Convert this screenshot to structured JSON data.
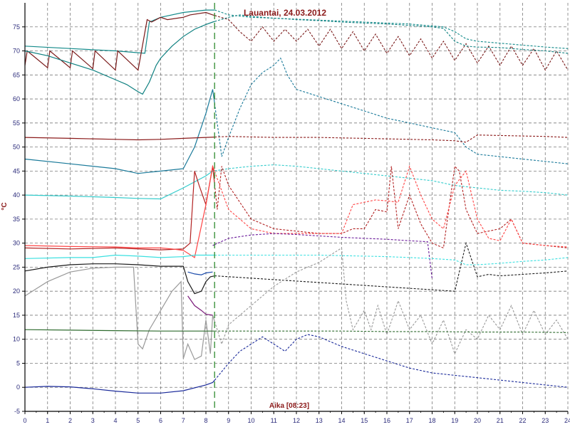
{
  "chart_data": {
    "type": "line",
    "title": "Lauantai, 24.03.2012",
    "ylabel": "°C",
    "xlabel_marker": "Aika [08:23]",
    "now_x": 8.3833,
    "xlim": [
      0,
      24
    ],
    "ylim": [
      -5,
      80
    ],
    "x_ticks": [
      "0",
      "1",
      "2",
      "3",
      "4",
      "5",
      "6",
      "7",
      "8",
      "9",
      "10",
      "11",
      "12",
      "13",
      "14",
      "15",
      "16",
      "17",
      "18",
      "19",
      "20",
      "21",
      "22",
      "23",
      "24"
    ],
    "y_ticks": [
      "-5",
      "0",
      "5",
      "10",
      "15",
      "20",
      "25",
      "30",
      "35",
      "40",
      "45",
      "50",
      "55",
      "60",
      "65",
      "70",
      "75"
    ],
    "grid": true,
    "colors": {
      "grid": "#7a7a7a",
      "axis": "#000000",
      "tick_text": "#2a2a7a",
      "title": "#8b1a1a",
      "marker_line": "#2e8b2e"
    },
    "series": [
      {
        "color": "#128a8a",
        "x": [
          0,
          2,
          4,
          5.3,
          5.5,
          6,
          7,
          8,
          8.4,
          9,
          10,
          11,
          12,
          13,
          14,
          15,
          16,
          17,
          18,
          18.5,
          19,
          19.5,
          20,
          21,
          22,
          23,
          24
        ],
        "y": [
          71,
          70.5,
          70,
          69.5,
          76,
          77,
          78,
          78.5,
          78.5,
          77.5,
          77,
          76.8,
          76.6,
          76.4,
          76.2,
          76,
          75.8,
          75.6,
          75.2,
          75,
          74,
          72.5,
          72,
          71.6,
          71.2,
          70.8,
          70.5
        ]
      },
      {
        "color": "#7a1a1a",
        "x": [
          0,
          0.1,
          1,
          1.1,
          2,
          2.1,
          3,
          3.1,
          4,
          4.1,
          5,
          5.4,
          5.6,
          6,
          6.3,
          7,
          7.3,
          8,
          8.3,
          9,
          9.5,
          10,
          10.5,
          11,
          11.5,
          12,
          12.5,
          13,
          13.5,
          14,
          14.5,
          15,
          15.5,
          16,
          16.5,
          17,
          17.5,
          18,
          18.5,
          19,
          19.5,
          20,
          20.5,
          21,
          21.5,
          22,
          22.5,
          23,
          23.5,
          24
        ],
        "y": [
          67,
          70,
          66.5,
          70,
          66.5,
          70,
          66.3,
          70,
          66,
          70,
          66,
          76.5,
          76,
          77,
          76.5,
          77,
          77.5,
          78,
          77.5,
          76.5,
          74,
          72,
          75,
          72,
          74.5,
          72,
          74.5,
          71,
          74.5,
          70.5,
          74,
          70,
          73.5,
          69.5,
          73,
          69,
          72.5,
          68.5,
          72,
          68,
          71.5,
          67.5,
          71,
          67,
          71,
          67,
          70.5,
          66,
          70,
          66
        ]
      },
      {
        "color": "#0e8080",
        "x": [
          0,
          1,
          2,
          3,
          4,
          4.5,
          5,
          5.2,
          5.5,
          5.8,
          6,
          6.5,
          7,
          7.5,
          8,
          8.3,
          9,
          9.5,
          10,
          10.5,
          11,
          11.5,
          12,
          13,
          14,
          15,
          16,
          17,
          18,
          18.5,
          19,
          19.5,
          20,
          21,
          22,
          23,
          24
        ],
        "y": [
          70,
          69,
          67.5,
          66,
          64,
          63,
          61.5,
          61,
          63.5,
          67,
          68.5,
          71,
          73,
          74.5,
          75.5,
          76,
          77,
          77.5,
          77.2,
          77,
          76.8,
          76.7,
          76.5,
          76.3,
          76,
          75.8,
          75.6,
          75.3,
          75,
          74.7,
          72,
          71,
          70.8,
          70.7,
          70.3,
          70,
          69.5
        ]
      },
      {
        "color": "#1a7a9a",
        "x": [
          0,
          2,
          4,
          5,
          6,
          7,
          7.5,
          8,
          8.3,
          8.7,
          9,
          9.5,
          10,
          10.5,
          11,
          11.3,
          11.6,
          12,
          13,
          14,
          15,
          16,
          17,
          18,
          18.5,
          19,
          19.5,
          20,
          21,
          22,
          23,
          24
        ],
        "y": [
          47.5,
          46.5,
          45.5,
          44.5,
          45,
          45.5,
          50,
          57,
          62,
          48,
          52,
          58,
          63,
          65.5,
          67,
          68.5,
          65,
          62,
          60.5,
          59,
          57.5,
          56,
          55,
          54,
          53.5,
          53,
          50,
          48.5,
          48,
          47.5,
          47,
          46.5
        ]
      },
      {
        "color": "#8b1a1a",
        "x": [
          0,
          2,
          4,
          5,
          6,
          7,
          8,
          9,
          10,
          11,
          12,
          13,
          14,
          15,
          16,
          17,
          18,
          19,
          19.5,
          20,
          21,
          22,
          23,
          24
        ],
        "y": [
          52,
          51.8,
          51.6,
          51.5,
          51.6,
          51.8,
          52,
          52.2,
          52.1,
          52,
          52,
          52,
          51.9,
          51.8,
          51.7,
          51.6,
          51.5,
          51.3,
          51,
          52.5,
          52.4,
          52.3,
          52.2,
          52
        ]
      },
      {
        "color": "#33cccc",
        "x": [
          0,
          2,
          4,
          5,
          6,
          7,
          8,
          8.3,
          9,
          10,
          11,
          12,
          13,
          14,
          15,
          16,
          17,
          18,
          19,
          20,
          21,
          22,
          23,
          24
        ],
        "y": [
          40,
          39.8,
          39.5,
          39.3,
          39.2,
          41.5,
          44,
          45,
          45.5,
          46,
          46.3,
          46,
          45.5,
          45,
          44.5,
          44,
          43.5,
          43,
          42,
          41.5,
          41,
          40.8,
          40.5,
          40
        ]
      },
      {
        "color": "#b22222",
        "x": [
          0,
          2,
          4,
          6,
          7,
          7.3,
          7.5,
          7.7,
          8,
          8.3,
          8.5,
          8.7,
          9,
          10,
          11,
          12,
          13,
          14,
          14.5,
          15,
          15.5,
          16,
          16.2,
          16.5,
          17,
          17.5,
          18,
          18.5,
          19,
          19.2,
          19.5,
          20,
          21,
          21.5,
          22,
          23,
          24
        ],
        "y": [
          29,
          28.8,
          29,
          28.6,
          28.8,
          30,
          45,
          42,
          38,
          46,
          37,
          46,
          42,
          35,
          33,
          32.5,
          32,
          32,
          33,
          33,
          37,
          36.5,
          46,
          33,
          40,
          34,
          30,
          29,
          46,
          45,
          37,
          32,
          33,
          35,
          30,
          29.5,
          29
        ]
      },
      {
        "color": "#ff4444",
        "x": [
          0,
          2,
          4,
          5,
          6,
          6.5,
          7,
          7.5,
          8,
          8.3,
          9,
          10,
          11,
          12,
          13,
          14,
          14.5,
          15,
          15.5,
          16,
          16.5,
          17,
          17.5,
          18,
          18.5,
          19,
          19.5,
          20,
          20.5,
          21,
          21.5,
          22,
          23,
          24
        ],
        "y": [
          29.5,
          29.3,
          29.2,
          29,
          29,
          28.8,
          28.5,
          27,
          38,
          46,
          37,
          33,
          32,
          32,
          32,
          32,
          38,
          38.5,
          39,
          38.8,
          38.5,
          46,
          40,
          35,
          33,
          42,
          45,
          35,
          31,
          30.5,
          35,
          30,
          29.5,
          29.2
        ]
      },
      {
        "color": "#6a1a9a",
        "x": [
          8.3,
          9,
          10,
          11,
          12,
          13,
          14,
          15,
          16,
          17,
          17.8,
          18
        ],
        "y": [
          29.5,
          31,
          31.7,
          32,
          31.8,
          31.5,
          31.2,
          31,
          30.8,
          30.5,
          30.3,
          22.5
        ]
      },
      {
        "color": "#3ae0e0",
        "x": [
          0,
          2,
          3,
          4,
          5,
          6,
          7,
          7.5,
          8,
          8.3,
          9,
          10,
          11,
          12,
          13,
          14,
          15,
          16,
          17,
          18,
          19,
          19.5,
          20,
          21,
          22,
          23,
          24
        ],
        "y": [
          26.8,
          27,
          27,
          27.5,
          27.3,
          27,
          27.2,
          27.5,
          27.5,
          27.5,
          27.5,
          27.5,
          27.5,
          27.5,
          27.5,
          27.4,
          27.3,
          27.2,
          27,
          26.8,
          26.5,
          25.5,
          25.5,
          25.8,
          26.2,
          26.5,
          27
        ]
      },
      {
        "color": "#1a1a1a",
        "x": [
          0,
          1,
          2,
          3,
          4,
          5,
          6,
          7,
          7.2,
          7.5,
          7.8,
          8,
          8.2,
          8.4,
          19,
          19.5,
          20,
          20.5,
          21,
          22,
          23,
          24
        ],
        "y": [
          24.2,
          25,
          25.5,
          25.7,
          25.7,
          25.5,
          25.2,
          25.2,
          22,
          19.5,
          20,
          22,
          23,
          23.2,
          20,
          30,
          23,
          23.5,
          23.2,
          23.5,
          23.8,
          24.2
        ]
      },
      {
        "color": "#999999",
        "x": [
          0,
          0.5,
          1,
          2,
          3,
          4,
          4.8,
          5,
          5.2,
          5.5,
          6,
          6.5,
          6.9,
          7,
          7.2,
          7.5,
          7.8,
          8,
          8.2,
          8.3,
          8.7,
          9,
          10,
          11,
          12,
          13,
          14,
          14.2,
          14.5,
          15,
          15.3,
          15.6,
          16,
          16.5,
          17,
          17.5,
          18,
          18.5,
          19,
          19.5,
          20,
          20.5,
          21,
          21.5,
          22,
          22.5,
          23,
          23.5,
          24
        ],
        "y": [
          19,
          20.5,
          22,
          24,
          24.8,
          25,
          25,
          9,
          8,
          12,
          16,
          20,
          22,
          6,
          9,
          5.8,
          6.5,
          14,
          7,
          15,
          9,
          13,
          17,
          21,
          24,
          26,
          29,
          18,
          12,
          16,
          12,
          17,
          11,
          18,
          12,
          15,
          9,
          14,
          7,
          12,
          10,
          15,
          12,
          17,
          11,
          16,
          11,
          14,
          10
        ]
      },
      {
        "color": "#2e6b2e",
        "x": [
          0,
          2,
          4,
          6,
          8,
          10,
          12,
          14,
          16,
          18,
          20,
          22,
          24
        ],
        "y": [
          12,
          11.9,
          11.8,
          11.7,
          11.7,
          11.7,
          11.7,
          11.7,
          11.6,
          11.6,
          11.5,
          11.5,
          11.4
        ]
      },
      {
        "color": "#1a2a9a",
        "x": [
          0,
          1,
          2,
          3,
          4,
          5,
          6,
          7,
          8,
          8.3,
          9,
          9.5,
          10,
          10.5,
          11,
          11.5,
          12,
          12.5,
          13,
          13.5,
          14,
          15,
          16,
          17,
          18,
          19,
          20,
          21,
          22,
          23,
          24
        ],
        "y": [
          0,
          0.2,
          0.1,
          -0.3,
          -0.8,
          -1.2,
          -1.2,
          -0.7,
          0.5,
          1,
          5,
          7.5,
          9,
          10.5,
          9,
          7.5,
          10,
          11,
          10.5,
          9.5,
          8.5,
          7,
          5.5,
          4,
          3,
          2.5,
          2,
          1.5,
          1,
          0.5,
          0
        ]
      },
      {
        "color": "#7a1a7a",
        "x": [
          7.2,
          7.5,
          7.8,
          8,
          8.3
        ],
        "y": [
          19,
          17,
          16,
          15.2,
          15
        ]
      },
      {
        "color": "#1a4aaa",
        "x": [
          7.2,
          7.5,
          7.8,
          8,
          8.3
        ],
        "y": [
          24,
          23.6,
          23.4,
          23.8,
          24
        ]
      }
    ]
  }
}
